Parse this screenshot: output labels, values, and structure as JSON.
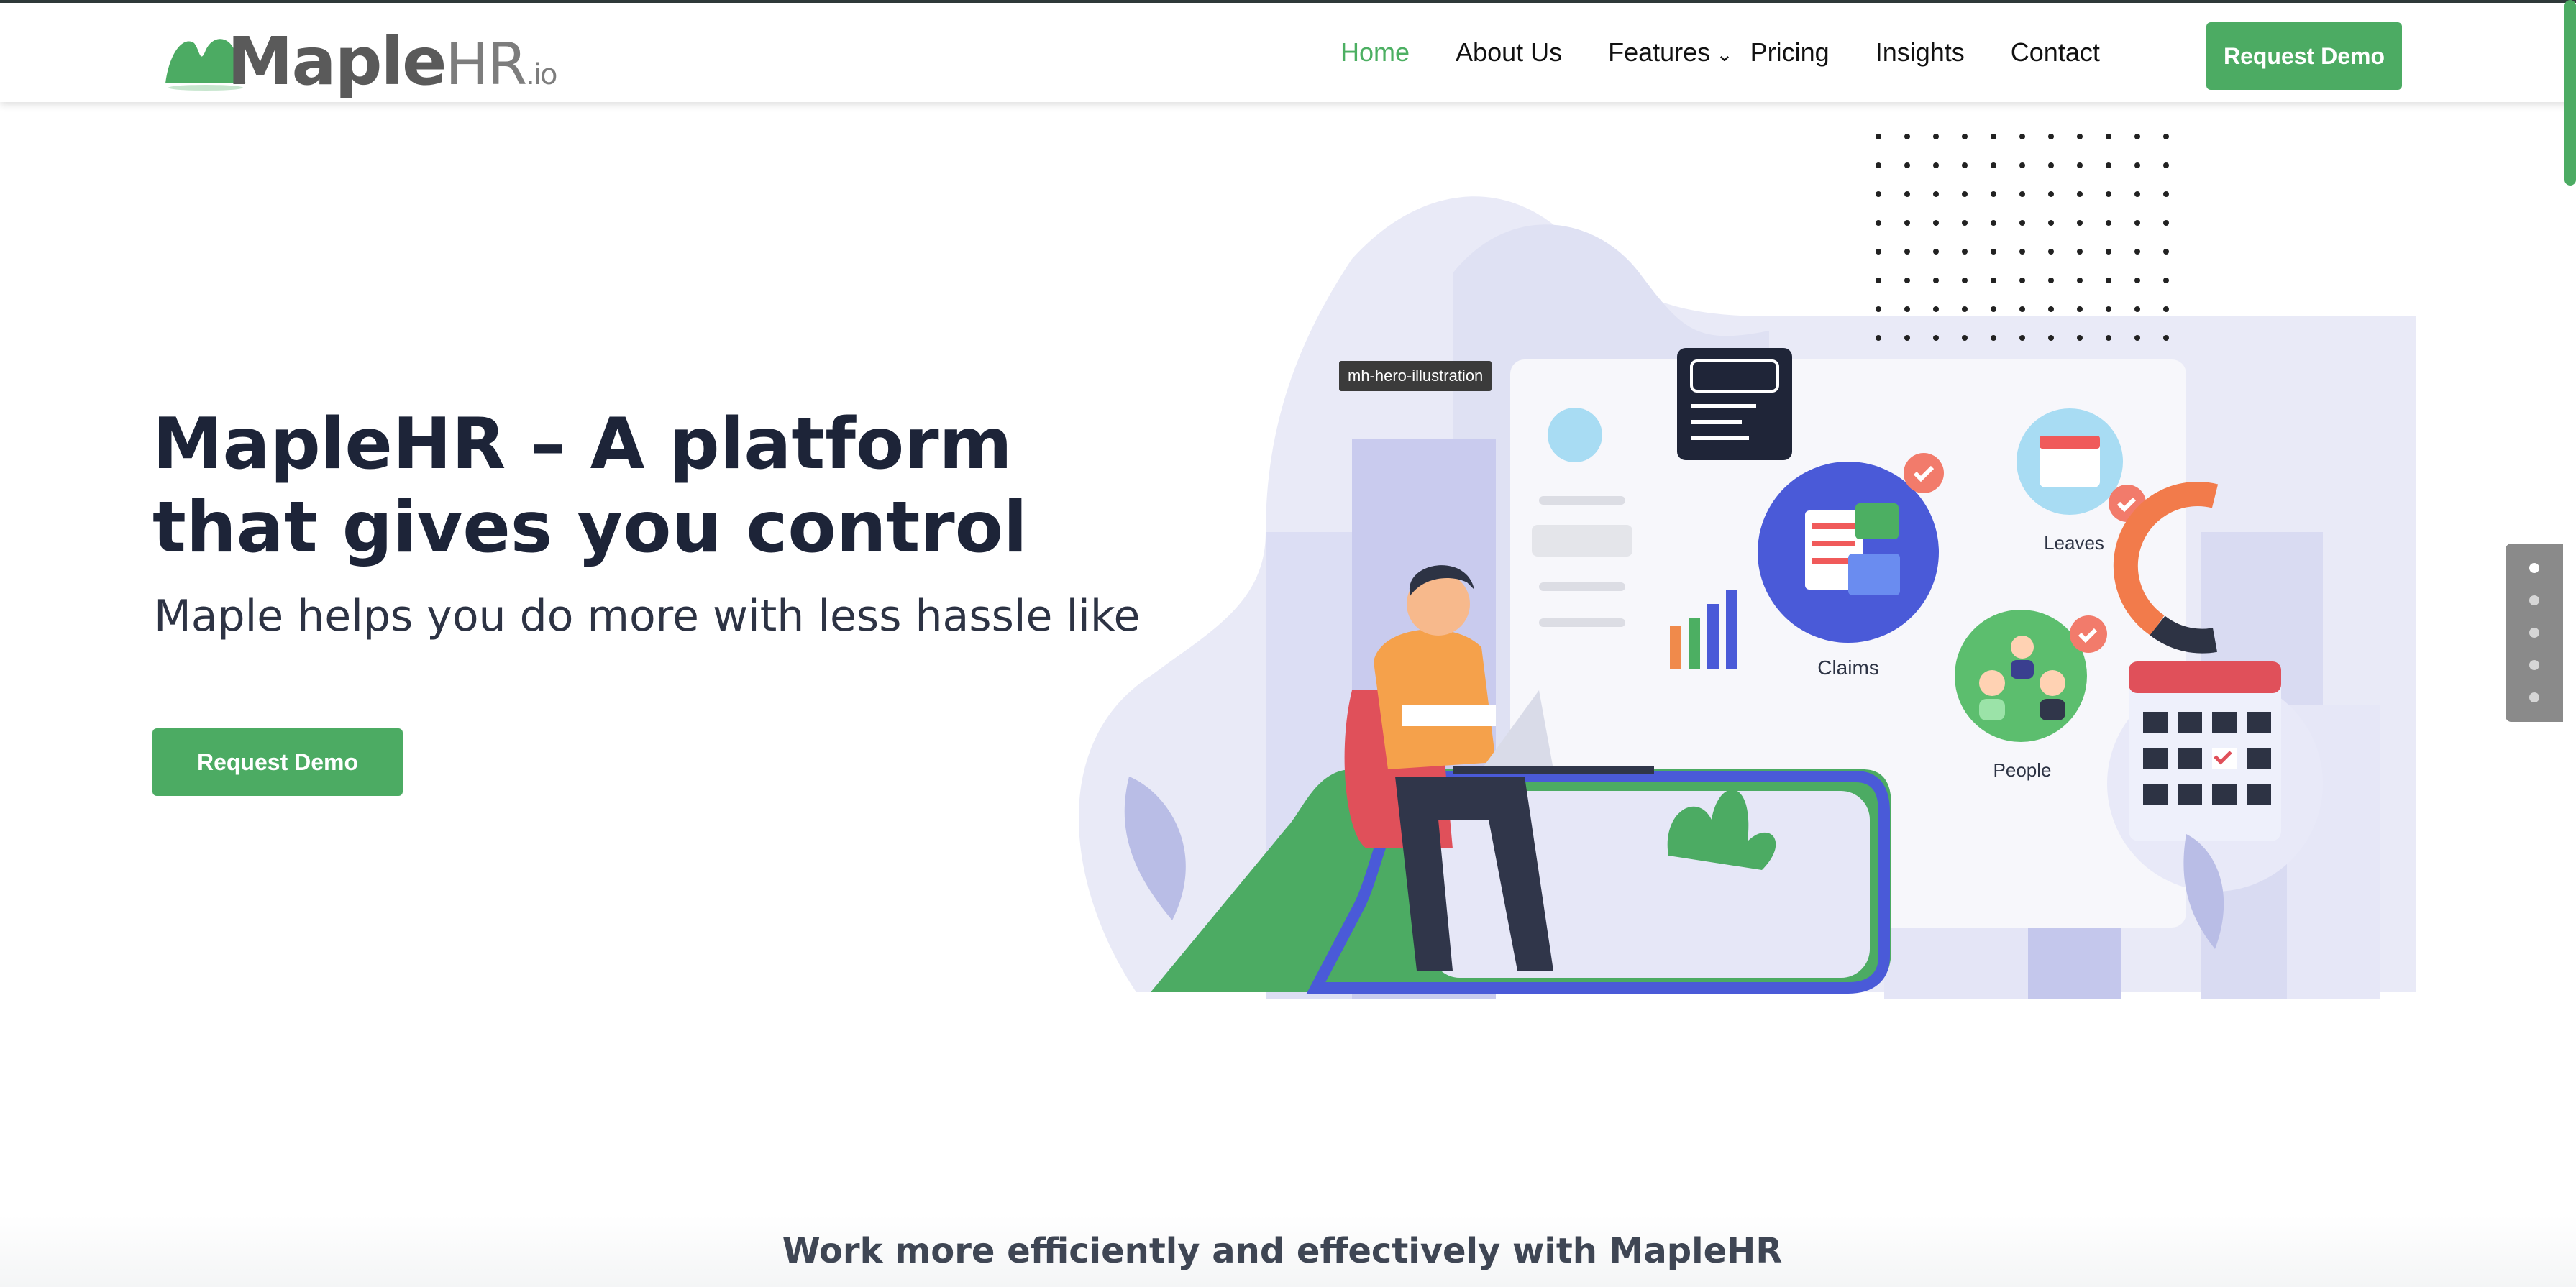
{
  "header": {
    "logo": {
      "main": "Maple",
      "suffix": "HR",
      "tld": ".io"
    },
    "nav": [
      {
        "label": "Home",
        "active": true
      },
      {
        "label": "About Us"
      },
      {
        "label": "Features",
        "has_dropdown": true
      },
      {
        "label": "Pricing"
      },
      {
        "label": "Insights"
      },
      {
        "label": "Contact"
      }
    ],
    "cta_label": "Request Demo"
  },
  "hero": {
    "title": "MapleHR – A platform that gives you control",
    "subtitle": "Maple helps you do more with less hassle like",
    "cta_label": "Request Demo",
    "illustration_tooltip": "mh-hero-illustration",
    "labels": {
      "claims": "Claims",
      "leaves": "Leaves",
      "people": "People"
    }
  },
  "section": {
    "title": "Work more efficiently and effectively with MapleHR"
  },
  "slide_nav": {
    "count": 5,
    "active_index": 0
  },
  "colors": {
    "accent_green": "#4cab63",
    "nav_active": "#4caf62",
    "heading": "#1d2438",
    "illustration_blue": "#4a5ad8"
  }
}
